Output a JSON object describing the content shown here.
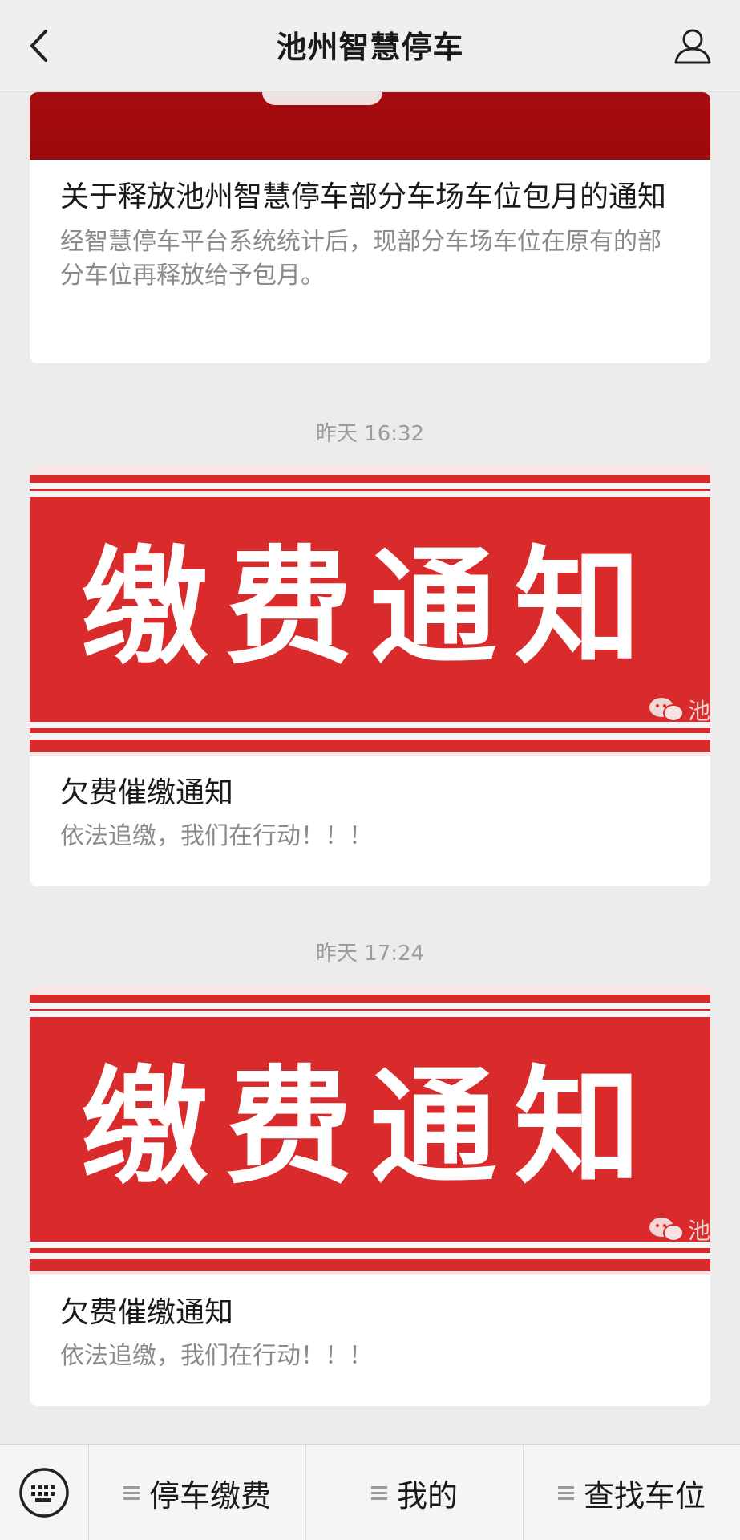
{
  "header": {
    "title": "池州智慧停车",
    "back_icon": "chevron-left-icon",
    "user_icon": "user-icon"
  },
  "feed": {
    "items": [
      {
        "title": "关于释放池州智慧停车部分车场车位包月的通知",
        "description": "经智慧停车平台系统统计后，现部分车场车位在原有的部分车位再释放给予包月。"
      },
      {
        "timestamp": "昨天 16:32",
        "banner_text": "缴费通知",
        "banner_watermark": "池",
        "title": "欠费催缴通知",
        "description": "依法追缴，我们在行动！！！"
      },
      {
        "timestamp": "昨天 17:24",
        "banner_text": "缴费通知",
        "banner_watermark": "池",
        "title": "欠费催缴通知",
        "description": "依法追缴，我们在行动！！！"
      }
    ]
  },
  "bottom_menu": {
    "keyboard_icon": "keyboard-icon",
    "items": [
      {
        "label": "停车缴费"
      },
      {
        "label": "我的"
      },
      {
        "label": "查找车位"
      }
    ]
  },
  "colors": {
    "banner_red": "#d92a2c",
    "banner_dark_red": "#9b0a0d",
    "background": "#ececec"
  }
}
